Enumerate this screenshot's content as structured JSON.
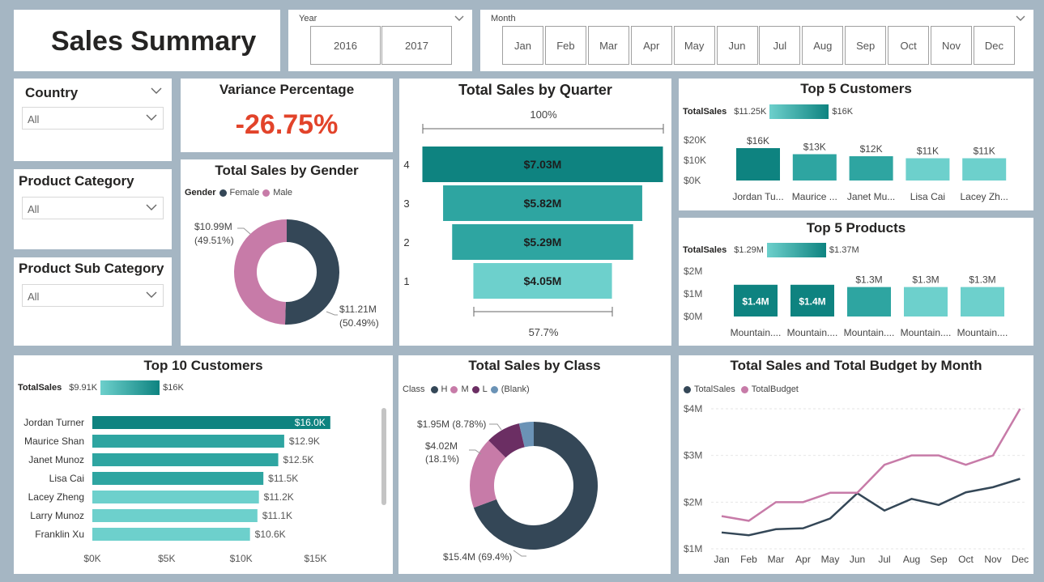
{
  "colors": {
    "teal_dark": "#0e8380",
    "teal_mid": "#2ea5a1",
    "teal_light": "#6dd0cc",
    "female": "#344757",
    "male": "#c77ba8",
    "class_h": "#344757",
    "class_m": "#c77ba8",
    "class_l": "#6b2e63",
    "class_blank": "#6b93b6",
    "variance": "#e2432a",
    "budget": "#c77ba8",
    "sales": "#344757"
  },
  "header": {
    "title": "Sales Summary"
  },
  "year_slicer": {
    "title": "Year",
    "options": [
      "2016",
      "2017"
    ]
  },
  "month_slicer": {
    "title": "Month",
    "options": [
      "Jan",
      "Feb",
      "Mar",
      "Apr",
      "May",
      "Jun",
      "Jul",
      "Aug",
      "Sep",
      "Oct",
      "Nov",
      "Dec"
    ]
  },
  "filters": {
    "country": {
      "title": "Country",
      "value": "All"
    },
    "product_category": {
      "title": "Product Category",
      "value": "All"
    },
    "product_sub_category": {
      "title": "Product Sub Category",
      "value": "All"
    }
  },
  "variance": {
    "title": "Variance Percentage",
    "value": "-26.75%"
  },
  "gender": {
    "title": "Total Sales by Gender",
    "legend_title": "Gender",
    "legend": [
      "Female",
      "Male"
    ],
    "male_label": "$10.99M",
    "male_pct": "(49.51%)",
    "female_label": "$11.21M",
    "female_pct": "(50.49%)"
  },
  "quarter": {
    "title": "Total Sales by Quarter",
    "top_pct": "100%",
    "bottom_pct": "57.7%"
  },
  "top5_customers": {
    "title": "Top 5 Customers",
    "legend_title": "TotalSales",
    "legend_min": "$11.25K",
    "legend_max": "$16K"
  },
  "top5_products": {
    "title": "Top 5 Products",
    "legend_title": "TotalSales",
    "legend_min": "$1.29M",
    "legend_max": "$1.37M"
  },
  "top10_customers": {
    "title": "Top 10 Customers",
    "legend_title": "TotalSales",
    "legend_min": "$9.91K",
    "legend_max": "$16K"
  },
  "class": {
    "title": "Total Sales by Class",
    "legend_title": "Class",
    "legend": [
      "H",
      "M",
      "L",
      "(Blank)"
    ],
    "l_label": "$1.95M (8.78%)",
    "m_label": "$4.02M",
    "m_pct": "(18.1%)",
    "h_label": "$15.4M (69.4%)"
  },
  "budget": {
    "title": "Total Sales and Total Budget by Month",
    "legend": [
      "TotalSales",
      "TotalBudget"
    ]
  },
  "chart_data": [
    {
      "id": "gender",
      "type": "pie",
      "title": "Total Sales by Gender",
      "categories": [
        "Female",
        "Male"
      ],
      "values": [
        11.21,
        10.99
      ],
      "unit": "$M"
    },
    {
      "id": "quarter",
      "type": "bar",
      "title": "Total Sales by Quarter",
      "categories": [
        "4",
        "3",
        "2",
        "1"
      ],
      "values": [
        7.03,
        5.82,
        5.29,
        4.05
      ],
      "labels": [
        "$7.03M",
        "$5.82M",
        "$5.29M",
        "$4.05M"
      ],
      "unit": "$M"
    },
    {
      "id": "top5_customers",
      "type": "bar",
      "title": "Top 5 Customers",
      "categories": [
        "Jordan Tu...",
        "Maurice ...",
        "Janet Mu...",
        "Lisa Cai",
        "Lacey Zh..."
      ],
      "values": [
        16,
        13,
        12,
        11,
        11
      ],
      "labels": [
        "$16K",
        "$13K",
        "$12K",
        "$11K",
        "$11K"
      ],
      "yticks": [
        "$20K",
        "$10K",
        "$0K"
      ],
      "ylim": [
        0,
        20
      ]
    },
    {
      "id": "top5_products",
      "type": "bar",
      "title": "Top 5 Products",
      "categories": [
        "Mountain....",
        "Mountain....",
        "Mountain....",
        "Mountain....",
        "Mountain...."
      ],
      "values": [
        1.4,
        1.4,
        1.3,
        1.3,
        1.3
      ],
      "labels": [
        "$1.4M",
        "$1.4M",
        "$1.3M",
        "$1.3M",
        "$1.3M"
      ],
      "yticks": [
        "$2M",
        "$1M",
        "$0M"
      ],
      "ylim": [
        0,
        2
      ]
    },
    {
      "id": "top10_customers",
      "type": "bar",
      "title": "Top 10 Customers",
      "categories": [
        "Jordan Turner",
        "Maurice Shan",
        "Janet Munoz",
        "Lisa Cai",
        "Lacey Zheng",
        "Larry Munoz",
        "Franklin Xu"
      ],
      "values": [
        16.0,
        12.9,
        12.5,
        11.5,
        11.2,
        11.1,
        10.6
      ],
      "labels": [
        "$16.0K",
        "$12.9K",
        "$12.5K",
        "$11.5K",
        "$11.2K",
        "$11.1K",
        "$10.6K"
      ],
      "xticks": [
        "$0K",
        "$5K",
        "$10K",
        "$15K"
      ],
      "xlim": [
        0,
        16.5
      ]
    },
    {
      "id": "class",
      "type": "pie",
      "title": "Total Sales by Class",
      "categories": [
        "H",
        "M",
        "L",
        "(Blank)"
      ],
      "values": [
        15.4,
        4.02,
        1.95,
        0.82
      ],
      "unit": "$M"
    },
    {
      "id": "budget",
      "type": "line",
      "title": "Total Sales and Total Budget by Month",
      "categories": [
        "Jan",
        "Feb",
        "Mar",
        "Apr",
        "May",
        "Jun",
        "Jul",
        "Aug",
        "Sep",
        "Oct",
        "Nov",
        "Dec"
      ],
      "yticks": [
        "$4M",
        "$3M",
        "$2M",
        "$1M"
      ],
      "ylim": [
        1,
        4
      ],
      "series": [
        {
          "name": "TotalSales",
          "values": [
            1.35,
            1.29,
            1.42,
            1.44,
            1.65,
            2.19,
            1.82,
            2.07,
            1.94,
            2.21,
            2.32,
            2.5
          ]
        },
        {
          "name": "TotalBudget",
          "values": [
            1.7,
            1.6,
            2.0,
            2.0,
            2.2,
            2.2,
            2.8,
            3.0,
            3.0,
            2.8,
            3.0,
            4.0
          ]
        }
      ]
    }
  ]
}
